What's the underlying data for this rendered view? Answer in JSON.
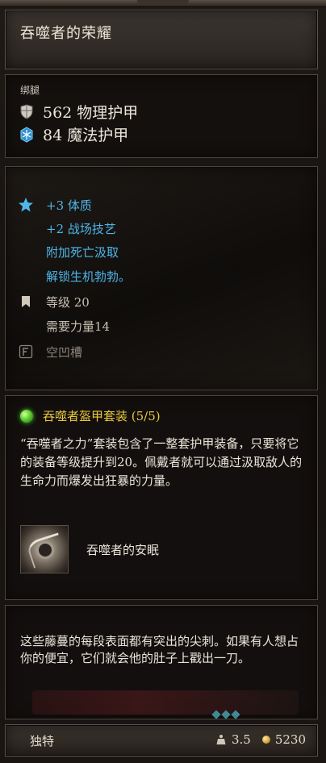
{
  "item": {
    "title": "吞噬者的荣耀",
    "slot": "绑腿"
  },
  "defense": [
    {
      "icon": "shield-icon",
      "text": "562 物理护甲"
    },
    {
      "icon": "snowflake-icon",
      "text": "84 魔法护甲"
    }
  ],
  "stats": {
    "bonus": [
      "+3 体质",
      "+2 战场技艺",
      "附加死亡汲取",
      "解锁生机勃勃。"
    ],
    "level": "等级 20",
    "requirement": "需要力量14",
    "socket": "空凹槽"
  },
  "set": {
    "title": "吞噬者盔甲套装 (5/5)",
    "description": "“吞噬者之力”套装包含了一整套护甲装备，只要将它的装备等级提升到20。佩戴者就可以通过汲取敌人的生命力而爆发出狂暴的力量。",
    "piece_name": "吞噬者的安眠"
  },
  "description": "这些藤蔓的每段表面都有突出的尖刺。如果有人想占你的便宜，它们就会他的肚子上戳出一刀。",
  "footer": {
    "rarity": "独特",
    "weight": "3.5",
    "value": "5230"
  },
  "colors": {
    "bonus": "#4fb6ea",
    "set_title": "#e8c93e"
  }
}
